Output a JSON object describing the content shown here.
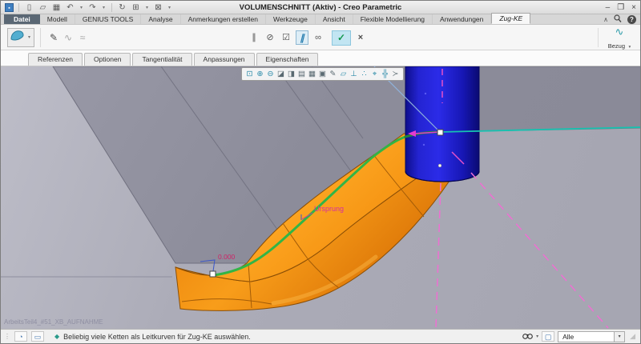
{
  "window": {
    "title": "VOLUMENSCHNITT (Aktiv) - Creo Parametric",
    "minimize_glyph": "–",
    "maximize_glyph": "❐",
    "close_glyph": "×"
  },
  "qat": {
    "caret": "▾",
    "items": [
      {
        "name": "app-icon",
        "glyph": "▪"
      },
      {
        "name": "new-file-icon",
        "glyph": "▯"
      },
      {
        "name": "open-icon",
        "glyph": "▱"
      },
      {
        "name": "save-icon",
        "glyph": "▦"
      },
      {
        "name": "undo-icon",
        "glyph": "↶"
      },
      {
        "name": "redo-icon",
        "glyph": "↷"
      },
      {
        "name": "regenerate-icon",
        "glyph": "↻"
      },
      {
        "name": "windows-icon",
        "glyph": "⊞"
      },
      {
        "name": "close-window-icon",
        "glyph": "⊠"
      }
    ]
  },
  "ribbon": {
    "tabs": [
      {
        "label": "Datei"
      },
      {
        "label": "Modell"
      },
      {
        "label": "GENIUS TOOLS"
      },
      {
        "label": "Analyse"
      },
      {
        "label": "Anmerkungen erstellen"
      },
      {
        "label": "Werkzeuge"
      },
      {
        "label": "Ansicht"
      },
      {
        "label": "Flexible Modellierung"
      },
      {
        "label": "Anwendungen"
      },
      {
        "label": "Zug-KE"
      }
    ],
    "collapse_glyph": "∧",
    "help_glyph": "?"
  },
  "dashboard": {
    "sweep_caret": "▾",
    "left_icons": [
      {
        "name": "sketch-icon",
        "glyph": "✎"
      },
      {
        "name": "chain-icon",
        "glyph": "∿"
      },
      {
        "name": "guide-icon",
        "glyph": "≈"
      }
    ],
    "middle_icons": [
      {
        "name": "pause-icon",
        "glyph": "∥"
      },
      {
        "name": "no-preview-icon",
        "glyph": "⊘"
      },
      {
        "name": "verify-icon",
        "glyph": "☑"
      },
      {
        "name": "preview-icon",
        "glyph": "∥"
      },
      {
        "name": "glasses-icon",
        "glyph": "∞"
      }
    ],
    "confirm_glyph": "✓",
    "cancel_glyph": "×",
    "bezug": {
      "icon_glyph": "∿",
      "label": "Bezug",
      "caret": "▾"
    }
  },
  "panel_tabs": [
    {
      "label": "Referenzen"
    },
    {
      "label": "Optionen"
    },
    {
      "label": "Tangentialität"
    },
    {
      "label": "Anpassungen"
    },
    {
      "label": "Eigenschaften"
    }
  ],
  "graphics": {
    "toolbar": [
      {
        "name": "refit-icon",
        "glyph": "⊡"
      },
      {
        "name": "zoom-in-icon",
        "glyph": "⊕"
      },
      {
        "name": "zoom-out-icon",
        "glyph": "⊖"
      },
      {
        "name": "named-views-icon",
        "glyph": "◪"
      },
      {
        "name": "display-style-icon",
        "glyph": "◨"
      },
      {
        "name": "saved-orientations-icon",
        "glyph": "▤"
      },
      {
        "name": "view-manager-icon",
        "glyph": "▦"
      },
      {
        "name": "capture-icon",
        "glyph": "▣"
      },
      {
        "name": "annotations-icon",
        "glyph": "✎"
      },
      {
        "name": "planes-display-icon",
        "glyph": "▱"
      },
      {
        "name": "axes-display-icon",
        "glyph": "⊥"
      },
      {
        "name": "points-display-icon",
        "glyph": "∴"
      },
      {
        "name": "csys-display-icon",
        "glyph": "⌖"
      },
      {
        "name": "spin-center-icon",
        "glyph": "╬"
      },
      {
        "name": "selection-filter-icon",
        "glyph": "≻"
      }
    ],
    "labels": {
      "origin": "Ursprung",
      "dimension": "0.000",
      "watermark": "ArbeitsTeil4_#51_XB_AUFNAHME"
    },
    "colors": {
      "sweep_orange": "#f08c10",
      "guide_green": "#32b546",
      "cylinder_blue": "#2323cd",
      "datum_magenta": "#ee6fd2",
      "chain_cyan": "#16c2b0"
    }
  },
  "statusbar": {
    "grip_glyph": "⋮",
    "icons": [
      {
        "name": "browser-icon",
        "glyph": "◔"
      },
      {
        "name": "sash-icon",
        "glyph": "▭"
      }
    ],
    "prompt_glyph": "◆",
    "message": "Beliebig viele Ketten als Leitkurven für Zug-KE auswählen.",
    "find_caret": "▾",
    "filter": {
      "value": "Alle",
      "caret": "▾"
    },
    "resize_glyph": "◢"
  }
}
